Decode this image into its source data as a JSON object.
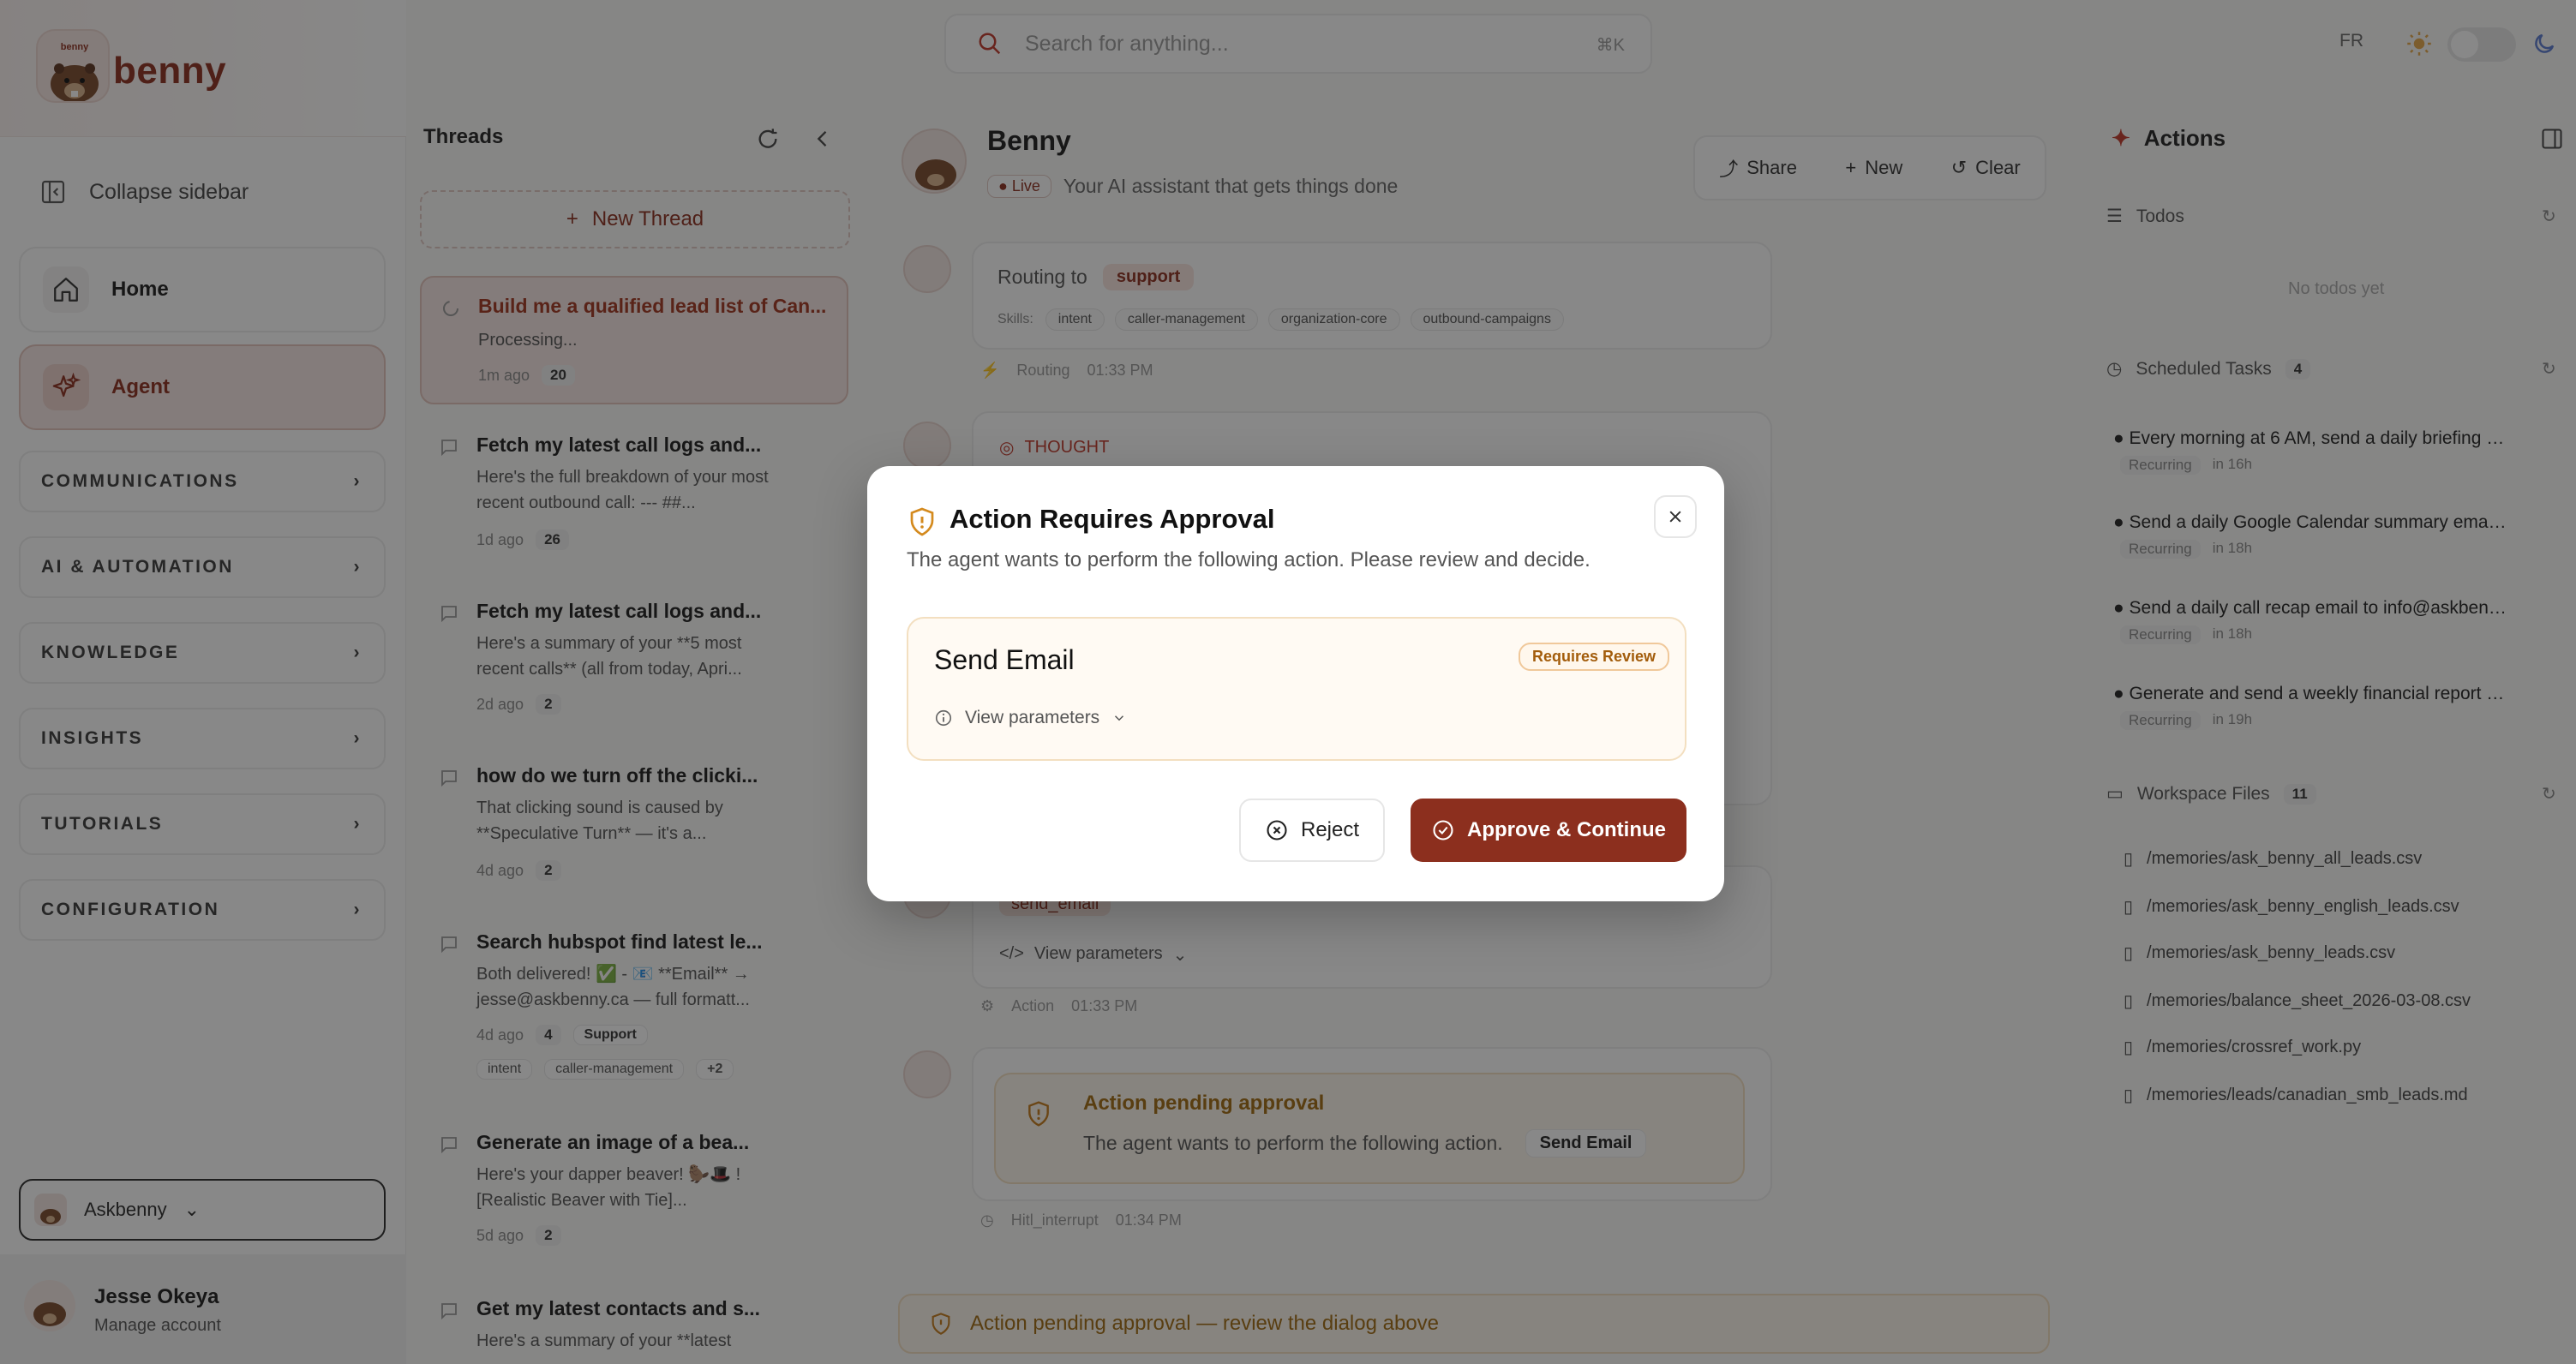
{
  "brand": {
    "name": "benny",
    "logo_text": "benny",
    "color": "#8c2f1e"
  },
  "sidebar": {
    "collapse_label": "Collapse sidebar",
    "nav": [
      {
        "label": "Home",
        "icon": "home-icon",
        "active": false
      },
      {
        "label": "Agent",
        "icon": "sparkle-icon",
        "active": true
      }
    ],
    "sections": [
      "COMMUNICATIONS",
      "AI & AUTOMATION",
      "KNOWLEDGE",
      "INSIGHTS",
      "TUTORIALS",
      "CONFIGURATION"
    ],
    "org": "Askbenny",
    "user": {
      "name": "Jesse Okeya",
      "sub": "Manage account"
    }
  },
  "search": {
    "placeholder": "Search for anything...",
    "shortcut": "⌘K"
  },
  "topbar": {
    "lang": "FR"
  },
  "threads": {
    "title": "Threads",
    "new_label": "New Thread",
    "items": [
      {
        "title": "Build me a qualified lead list of Can...",
        "preview": "Processing...",
        "age": "1m ago",
        "count": "20",
        "tags": []
      },
      {
        "title": "Fetch my latest call logs and...",
        "preview": "Here's the full breakdown of your most recent outbound call: --- ##...",
        "age": "1d ago",
        "count": "26",
        "tags": []
      },
      {
        "title": "Fetch my latest call logs and...",
        "preview": "Here's a summary of your **5 most recent calls** (all from today, Apri...",
        "age": "2d ago",
        "count": "2",
        "tags": []
      },
      {
        "title": "how do we turn off the clicki...",
        "preview": "That clicking sound is caused by **Speculative Turn** — it's a...",
        "age": "4d ago",
        "count": "2",
        "tags": []
      },
      {
        "title": "Search hubspot find latest le...",
        "preview": "Both delivered! ✅ - 📧 **Email** → jesse@askbenny.ca — full formatt...",
        "age": "4d ago",
        "count": "4",
        "tags": [
          "Support",
          "intent",
          "caller-management",
          "+2"
        ]
      },
      {
        "title": "Generate an image of a bea...",
        "preview": "Here's your dapper beaver! 🦫🎩 ![Realistic Beaver with Tie]...",
        "age": "5d ago",
        "count": "2",
        "tags": []
      },
      {
        "title": "Get my latest contacts and s...",
        "preview": "Here's a summary of your **latest",
        "age": "",
        "count": "",
        "tags": []
      }
    ]
  },
  "chat": {
    "name": "Benny",
    "live": "Live",
    "tagline": "Your AI assistant that gets things done",
    "buttons": {
      "share": "Share",
      "new": "New",
      "clear": "Clear"
    },
    "routing": {
      "label": "Routing to",
      "target": "support",
      "skills_label": "Skills:",
      "skills": [
        "intent",
        "caller-management",
        "organization-core",
        "outbound-campaigns"
      ],
      "meta": "Routing",
      "time": "01:33 PM"
    },
    "thought": {
      "label": "THOUGHT"
    },
    "action": {
      "tool": "send_email",
      "view": "View parameters",
      "meta": "Action",
      "time": "01:33 PM"
    },
    "pending": {
      "title": "Action pending approval",
      "body": "The agent wants to perform the following action.",
      "pill": "Send Email",
      "meta": "Hitl_interrupt",
      "time": "01:34 PM"
    },
    "banner": "Action pending approval — review the dialog above"
  },
  "actions": {
    "title": "Actions",
    "todos": {
      "label": "Todos",
      "empty": "No todos yet"
    },
    "scheduled": {
      "label": "Scheduled Tasks",
      "count": "4",
      "items": [
        {
          "title": "Every morning at 6 AM, send a daily briefing SI...",
          "type": "Recurring",
          "when": "in 16h"
        },
        {
          "title": "Send a daily Google Calendar summary email t...",
          "type": "Recurring",
          "when": "in 18h"
        },
        {
          "title": "Send a daily call recap email to info@askbenny....",
          "type": "Recurring",
          "when": "in 18h"
        },
        {
          "title": "Generate and send a weekly financial report to ...",
          "type": "Recurring",
          "when": "in 19h"
        }
      ]
    },
    "files": {
      "label": "Workspace Files",
      "count": "11",
      "items": [
        "/memories/ask_benny_all_leads.csv",
        "/memories/ask_benny_english_leads.csv",
        "/memories/ask_benny_leads.csv",
        "/memories/balance_sheet_2026-03-08.csv",
        "/memories/crossref_work.py",
        "/memories/leads/canadian_smb_leads.md"
      ]
    }
  },
  "modal": {
    "title": "Action Requires Approval",
    "subtitle": "The agent wants to perform the following action. Please review and decide.",
    "action_name": "Send Email",
    "badge": "Requires Review",
    "params": "View parameters",
    "reject": "Reject",
    "approve": "Approve & Continue"
  }
}
